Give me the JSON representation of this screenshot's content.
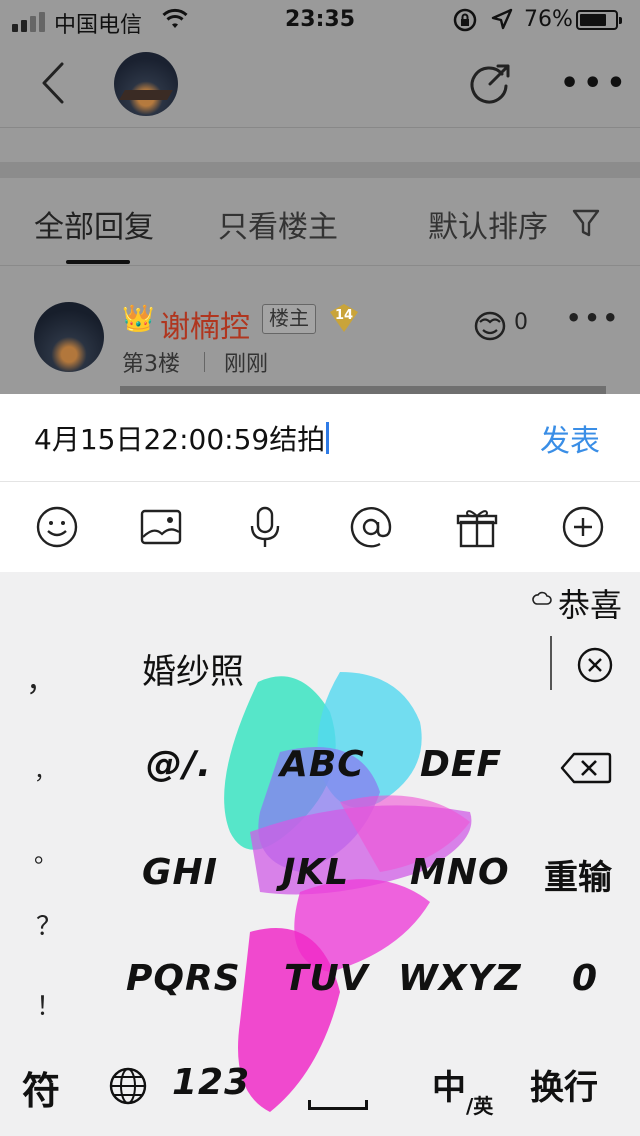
{
  "status_bar": {
    "carrier": "中国电信",
    "time": "23:35",
    "battery_percent": "76%",
    "battery_level": 0.76
  },
  "nav": {
    "back_icon": "chevron-left-icon",
    "share_icon": "share-arrow-icon",
    "more_icon": "ellipsis-icon"
  },
  "tabs": {
    "all_replies": "全部回复",
    "owner_only": "只看楼主",
    "sort": "默认排序",
    "filter_icon": "funnel-icon"
  },
  "reply": {
    "username": "谢楠控",
    "owner_badge": "楼主",
    "level": "14",
    "floor": "第3楼",
    "time": "刚刚",
    "like_count": "0",
    "accent_color": "#b0361f"
  },
  "composer": {
    "input_value": "4月15日22:00:59结拍",
    "send_label": "发表",
    "send_color": "#3a8ee6",
    "tools": [
      "emoji-icon",
      "image-icon",
      "microphone-icon",
      "at-icon",
      "gift-icon",
      "plus-icon"
    ]
  },
  "keyboard": {
    "cloud_candidate": "恭喜",
    "candidate": "婚纱照",
    "punctuation": [
      "，",
      "，",
      "。",
      "？",
      "！"
    ],
    "row1": [
      "@/.",
      "ABC",
      "DEF"
    ],
    "row2": [
      "GHI",
      "JKL",
      "MNO",
      "重输"
    ],
    "row3": [
      "PQRS",
      "TUV",
      "WXYZ",
      "0"
    ],
    "bottom": {
      "symbols": "符",
      "numbers": "123",
      "lang_main": "中",
      "lang_sub": "/英",
      "newline": "换行"
    }
  }
}
